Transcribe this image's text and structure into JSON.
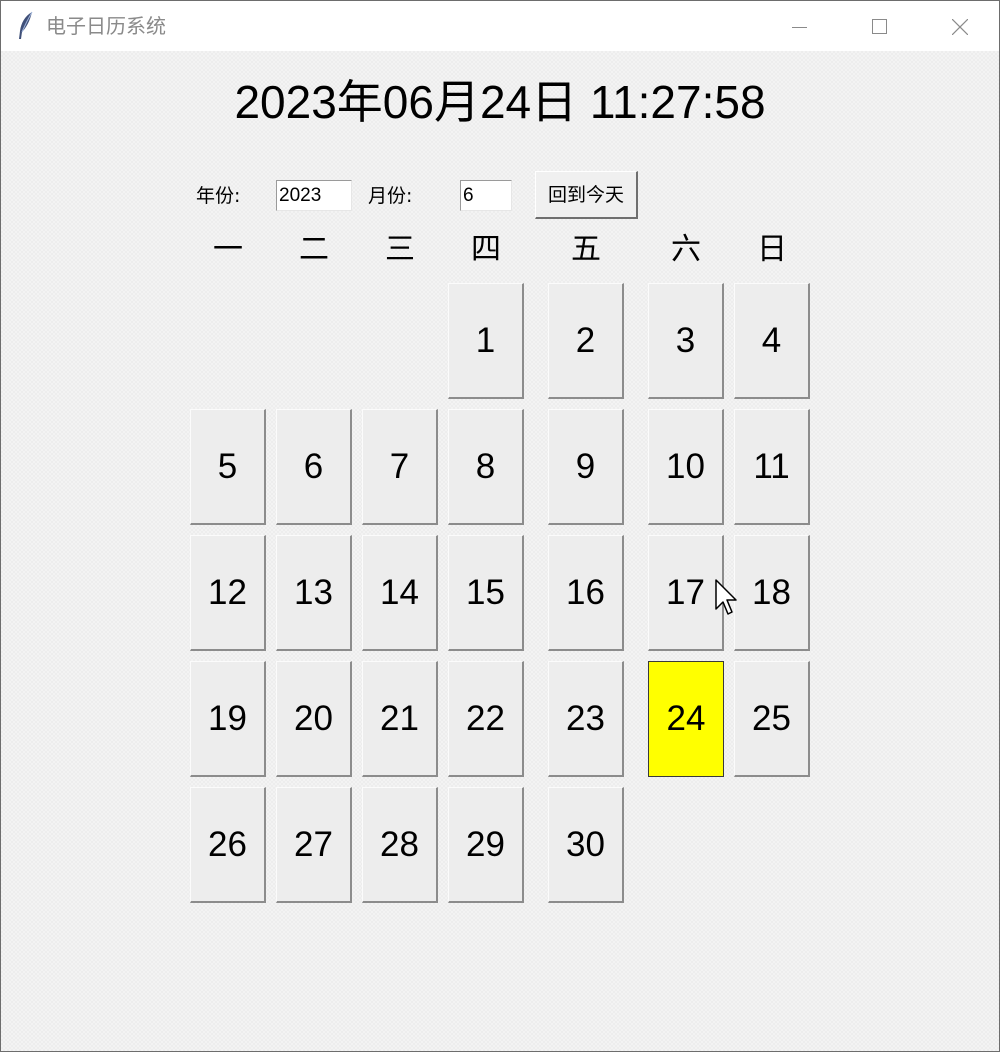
{
  "window": {
    "title": "电子日历系统"
  },
  "clock": {
    "datetime": "2023年06月24日 11:27:58"
  },
  "controls": {
    "year_label": "年份:",
    "year_value": "2023",
    "month_label": "月份:",
    "month_value": "6",
    "today_button": "回到今天"
  },
  "weekdays": [
    "一",
    "二",
    "三",
    "四",
    "五",
    "六",
    "日"
  ],
  "days": [
    "1",
    "2",
    "3",
    "4",
    "5",
    "6",
    "7",
    "8",
    "9",
    "10",
    "11",
    "12",
    "13",
    "14",
    "15",
    "16",
    "17",
    "18",
    "19",
    "20",
    "21",
    "22",
    "23",
    "24",
    "25",
    "26",
    "27",
    "28",
    "29",
    "30"
  ],
  "today": "24",
  "colors": {
    "today_highlight": "#ffff00",
    "button_face": "#ededed",
    "titlebar": "#ffffff"
  },
  "icons": {
    "app": "feather-icon",
    "minimize": "minimize-icon",
    "maximize": "maximize-icon",
    "close": "close-icon",
    "cursor": "mouse-pointer-icon"
  }
}
